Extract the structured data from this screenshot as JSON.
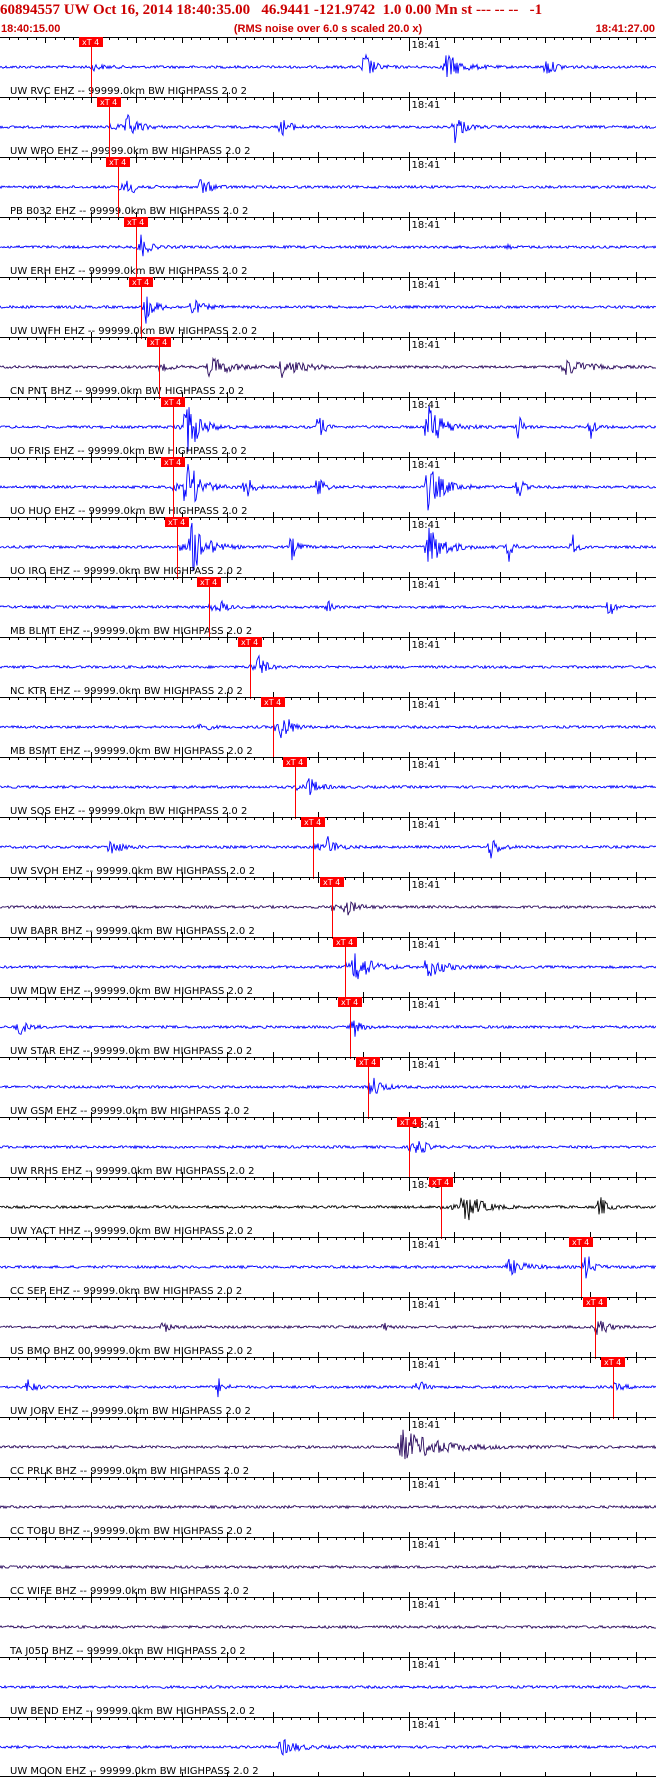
{
  "header": {
    "title": "60894557 UW Oct 16, 2014 18:40:35.00   46.9441 -121.9742  1.0 0.00 Mn st --- -- --   -1",
    "start_time": "18:40:15.00",
    "note": "(RMS noise over 6.0 s scaled 20.0 x)",
    "end_time": "18:41:27.00"
  },
  "chart_data": {
    "type": "line",
    "title": "60894557 UW Oct 16, 2014 18:40:35.00   46.9441 -121.9742  1.0 0.00 Mn st --- -- --   -1",
    "x_range": [
      "18:40:15.00",
      "18:41:27.00"
    ],
    "x_range_seconds": [
      0,
      72
    ],
    "minute_mark": "18:41",
    "minute_mark_seconds": 45,
    "tick_interval_seconds": 1,
    "pick_marker_label": "xT 4",
    "colors": {
      "blue": "#0000ff",
      "purple": "#2a0a5e",
      "black": "#000000",
      "pick": "#ff0000"
    },
    "traces": [
      {
        "label": "UW RVC EHZ -- 99999.0km BW  HIGHPASS  2.0  2",
        "color": "blue",
        "pick_s": 10.0,
        "bursts": [
          [
            40,
            3.2,
            0.8
          ],
          [
            49,
            2.6,
            1.4
          ],
          [
            60,
            1.6,
            1.0
          ]
        ]
      },
      {
        "label": "UW WPO EHZ -- 99999.0km BW  HIGHPASS  2.0  2",
        "color": "blue",
        "pick_s": 12.0,
        "bursts": [
          [
            14,
            2.2,
            1.0
          ],
          [
            50,
            3.0,
            0.8
          ],
          [
            31,
            1.6,
            0.9
          ]
        ]
      },
      {
        "label": "PB B032 EHZ -- 99999.0km BW  HIGHPASS  2.0  2",
        "color": "blue",
        "pick_s": 13.0,
        "bursts": [
          [
            22,
            1.6,
            1.0
          ],
          [
            14,
            1.5,
            0.8
          ]
        ]
      },
      {
        "label": "UW ERH EHZ -- 99999.0km BW  HIGHPASS  2.0  2",
        "color": "blue",
        "pick_s": 15.0,
        "bursts": [
          [
            15.5,
            1.8,
            0.6
          ],
          [
            56,
            1.8,
            0.1
          ]
        ]
      },
      {
        "label": "UW UWFH EHZ -- 99999.0km BW  HIGHPASS  2.0  2",
        "color": "blue",
        "pick_s": 15.5,
        "bursts": [
          [
            16,
            2.4,
            0.8
          ],
          [
            21,
            1.6,
            1.0
          ]
        ]
      },
      {
        "label": "CN PNT BHZ -- 99999.0km BW  HIGHPASS  2.0  2",
        "color": "purple",
        "pick_s": 17.5,
        "bursts": [
          [
            23,
            1.8,
            2.0
          ],
          [
            31,
            1.6,
            2.0
          ],
          [
            62,
            1.6,
            2.0
          ]
        ]
      },
      {
        "label": "UO FRIS EHZ -- 99999.0km BW  HIGHPASS  2.0  2",
        "color": "blue",
        "pick_s": 19.0,
        "bursts": [
          [
            20.5,
            5.0,
            1.2
          ],
          [
            35,
            3.0,
            0.5
          ],
          [
            47,
            4.0,
            1.5
          ],
          [
            57,
            3.0,
            0.4
          ],
          [
            65,
            3.0,
            0.4
          ]
        ]
      },
      {
        "label": "UO HUO EHZ -- 99999.0km BW  HIGHPASS  2.0  2",
        "color": "blue",
        "pick_s": 19.0,
        "bursts": [
          [
            20.5,
            5.0,
            1.2
          ],
          [
            27,
            2.6,
            0.6
          ],
          [
            35,
            3.0,
            0.5
          ],
          [
            47,
            4.0,
            1.5
          ],
          [
            57,
            3.0,
            0.4
          ]
        ]
      },
      {
        "label": "UO IRO EHZ -- 99999.0km BW  HIGHPASS  2.0  2",
        "color": "blue",
        "pick_s": 19.5,
        "bursts": [
          [
            21,
            5.0,
            1.3
          ],
          [
            32,
            2.6,
            0.6
          ],
          [
            47,
            4.0,
            1.5
          ],
          [
            56,
            2.6,
            0.4
          ],
          [
            63,
            2.4,
            0.4
          ]
        ]
      },
      {
        "label": "MB BLMT EHZ -- 99999.0km BW  HIGHPASS  2.0  2",
        "color": "blue",
        "pick_s": 23.0,
        "bursts": [
          [
            24.5,
            1.8,
            0.3
          ],
          [
            36,
            1.8,
            0.3
          ],
          [
            67,
            3.0,
            0.4
          ]
        ]
      },
      {
        "label": "NC KTR EHZ -- 99999.0km BW  HIGHPASS  2.0  2",
        "color": "blue",
        "pick_s": 27.5,
        "bursts": [
          [
            28.5,
            2.6,
            0.5
          ]
        ]
      },
      {
        "label": "MB BSMT EHZ -- 99999.0km BW  HIGHPASS  2.0  2",
        "color": "blue",
        "pick_s": 30.0,
        "bursts": [
          [
            31,
            3.4,
            0.7
          ],
          [
            22,
            1.4,
            0.6
          ]
        ]
      },
      {
        "label": "UW SQS EHZ -- 99999.0km BW  HIGHPASS  2.0  2",
        "color": "blue",
        "pick_s": 32.5,
        "bursts": [
          [
            34,
            1.6,
            0.8
          ]
        ]
      },
      {
        "label": "UW SVOH EHZ -- 99999.0km BW  HIGHPASS  2.0  2",
        "color": "blue",
        "pick_s": 34.5,
        "bursts": [
          [
            36,
            1.8,
            0.8
          ],
          [
            12,
            1.6,
            1.0
          ],
          [
            54,
            2.2,
            0.8
          ]
        ]
      },
      {
        "label": "UW BABR BHZ -- 99999.0km BW  HIGHPASS  2.0  2",
        "color": "purple",
        "pick_s": 36.5,
        "bursts": [
          [
            38,
            1.4,
            1.0
          ]
        ]
      },
      {
        "label": "UW MDW EHZ -- 99999.0km BW  HIGHPASS  2.0  2",
        "color": "blue",
        "pick_s": 38.0,
        "bursts": [
          [
            39,
            2.8,
            1.5
          ],
          [
            47,
            2.0,
            1.5
          ]
        ]
      },
      {
        "label": "UW STAR EHZ -- 99999.0km BW  HIGHPASS  2.0  2",
        "color": "blue",
        "pick_s": 38.5,
        "bursts": [
          [
            2,
            1.6,
            0.8
          ],
          [
            39,
            1.4,
            0.4
          ]
        ]
      },
      {
        "label": "UW GSM EHZ -- 99999.0km BW  HIGHPASS  2.0  2",
        "color": "blue",
        "pick_s": 40.5,
        "bursts": [
          [
            41,
            1.6,
            0.8
          ]
        ]
      },
      {
        "label": "UW RRHS EHZ -- 99999.0km BW  HIGHPASS  2.0  2",
        "color": "blue",
        "pick_s": 45.0,
        "bursts": [
          [
            46,
            1.8,
            0.6
          ]
        ]
      },
      {
        "label": "UW YACT HHZ -- 99999.0km BW  HIGHPASS  2.0  2",
        "color": "black",
        "pick_s": 48.5,
        "bursts": [
          [
            51,
            3.0,
            1.5
          ],
          [
            66,
            2.4,
            0.6
          ]
        ]
      },
      {
        "label": "CC SEP EHZ -- 99999.0km BW  HIGHPASS  2.0  2",
        "color": "blue",
        "pick_s": 64.0,
        "bursts": [
          [
            64.5,
            2.6,
            0.5
          ],
          [
            56,
            1.4,
            1.5
          ]
        ]
      },
      {
        "label": "US BMO BHZ 00 99999.0km BW  HIGHPASS  2.0  2",
        "color": "purple",
        "pick_s": 65.5,
        "bursts": [
          [
            18,
            1.6,
            0.4
          ],
          [
            42,
            1.4,
            0.4
          ],
          [
            66,
            2.2,
            0.5
          ]
        ]
      },
      {
        "label": "UW JORV EHZ -- 99999.0km BW  HIGHPASS  2.0  2",
        "color": "blue",
        "pick_s": 67.5,
        "bursts": [
          [
            3,
            1.6,
            0.6
          ],
          [
            24,
            1.6,
            0.6
          ],
          [
            46,
            1.4,
            0.6
          ]
        ]
      },
      {
        "label": "CC PRLK BHZ -- 99999.0km BW  HIGHPASS  2.0  2",
        "color": "purple",
        "pick_s": null,
        "bursts": [
          [
            44,
            3.0,
            3.5
          ]
        ]
      },
      {
        "label": "CC TOBU BHZ -- 99999.0km BW  HIGHPASS  2.0  2",
        "color": "purple",
        "pick_s": null,
        "bursts": []
      },
      {
        "label": "CC WIFE BHZ -- 99999.0km BW  HIGHPASS  2.0  2",
        "color": "purple",
        "pick_s": null,
        "bursts": []
      },
      {
        "label": "TA J05D BHZ -- 99999.0km BW  HIGHPASS  2.0  2",
        "color": "purple",
        "pick_s": null,
        "bursts": []
      },
      {
        "label": "UW BEND EHZ -- 99999.0km BW  HIGHPASS  2.0  2",
        "color": "blue",
        "pick_s": null,
        "bursts": []
      },
      {
        "label": "UW MOON EHZ -- 99999.0km BW  HIGHPASS  2.0  2",
        "color": "blue",
        "pick_s": null,
        "bursts": [
          [
            31,
            1.4,
            1.5
          ]
        ]
      }
    ]
  }
}
